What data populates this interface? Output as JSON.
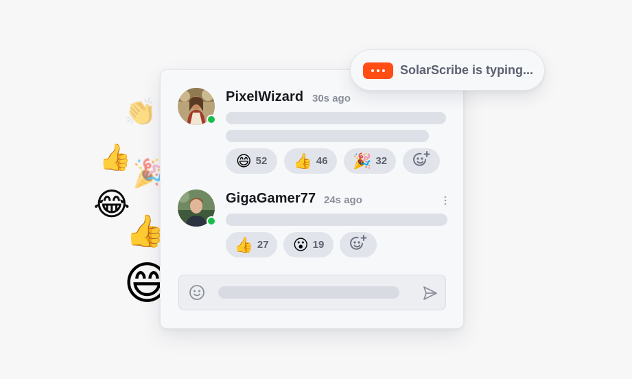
{
  "floating_emojis": [
    "👏",
    "👍",
    "🎉",
    "😂",
    "👍",
    "😄"
  ],
  "typing_indicator": {
    "text": "SolarScribe is typing...",
    "accent": "#ff4d14"
  },
  "messages": [
    {
      "user": "PixelWizard",
      "time": "30s ago",
      "online": true,
      "reactions": [
        {
          "emoji": "😄",
          "count": "52"
        },
        {
          "emoji": "👍",
          "count": "46"
        },
        {
          "emoji": "🎉",
          "count": "32"
        }
      ]
    },
    {
      "user": "GigaGamer77",
      "time": "24s ago",
      "online": true,
      "reactions": [
        {
          "emoji": "👍",
          "count": "27"
        },
        {
          "emoji": "😮",
          "count": "19"
        }
      ]
    }
  ],
  "colors": {
    "online": "#1bbd4a",
    "reaction_bg": "#e1e4ea",
    "placeholder_bar": "#dde0e6"
  },
  "icons": {
    "add_reaction": "smiley-plus-icon",
    "composer_emoji": "smiley-icon",
    "send": "paper-plane-icon",
    "more": "vertical-dots-icon"
  }
}
